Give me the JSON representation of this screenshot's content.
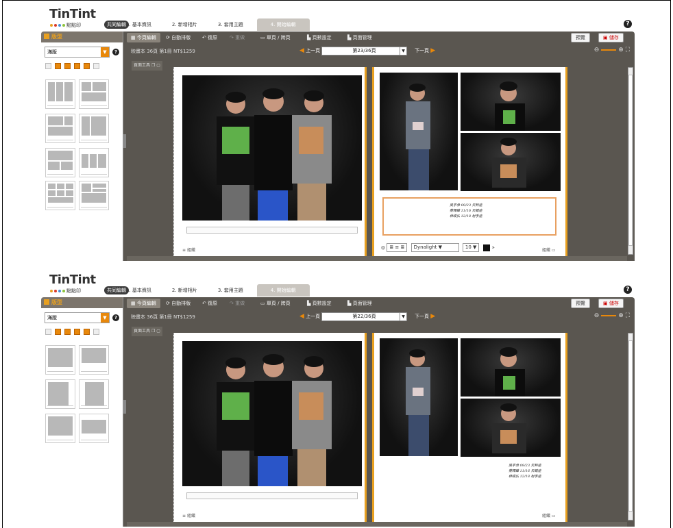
{
  "brand": {
    "logo": "TinTint",
    "tagline": "點點印",
    "badge": "共同編輯",
    "dot_colors": [
      "#e8a020",
      "#d93a2a",
      "#4a8fd6",
      "#8cc43c"
    ]
  },
  "steps": [
    "1. 基本資訊",
    "2. 新增相片",
    "3. 套用主題",
    "4. 開始編輯"
  ],
  "help_icon": "?",
  "sidebar": {
    "title": "版型",
    "select_value": "滿版"
  },
  "toolbar": {
    "items": [
      "今頁編輯",
      "自動排版",
      "復原",
      "重做",
      "單頁 / 跨頁",
      "頁數設定",
      "頁面管理"
    ],
    "preview": "預覽",
    "save": "儲存"
  },
  "panels": [
    {
      "info": "映畫本 36頁 第1冊 NT$1259",
      "prev": "上一頁",
      "next": "下一頁",
      "page_select": "第23/36頁",
      "page_tools": "頁面工具",
      "left_page_num": "組織",
      "right_page_num": "組織",
      "font_name": "Dynalight",
      "font_size": "10",
      "poem": [
        "吳宇承 09/23 天秤座",
        "蔡釋緯 11/16 天蠍座",
        "林峻弘 12/18 射手座"
      ]
    },
    {
      "info": "映畫本 36頁 第1冊 NT$1259",
      "prev": "上一頁",
      "next": "下一頁",
      "page_select": "第22/36頁",
      "page_tools": "頁面工具",
      "left_page_num": "組織",
      "right_page_num": "組織",
      "poem": [
        "吳宇承 09/23 天秤座",
        "蔡釋緯 11/16 天蠍座",
        "林峻弘 12/18 射手座"
      ]
    }
  ]
}
